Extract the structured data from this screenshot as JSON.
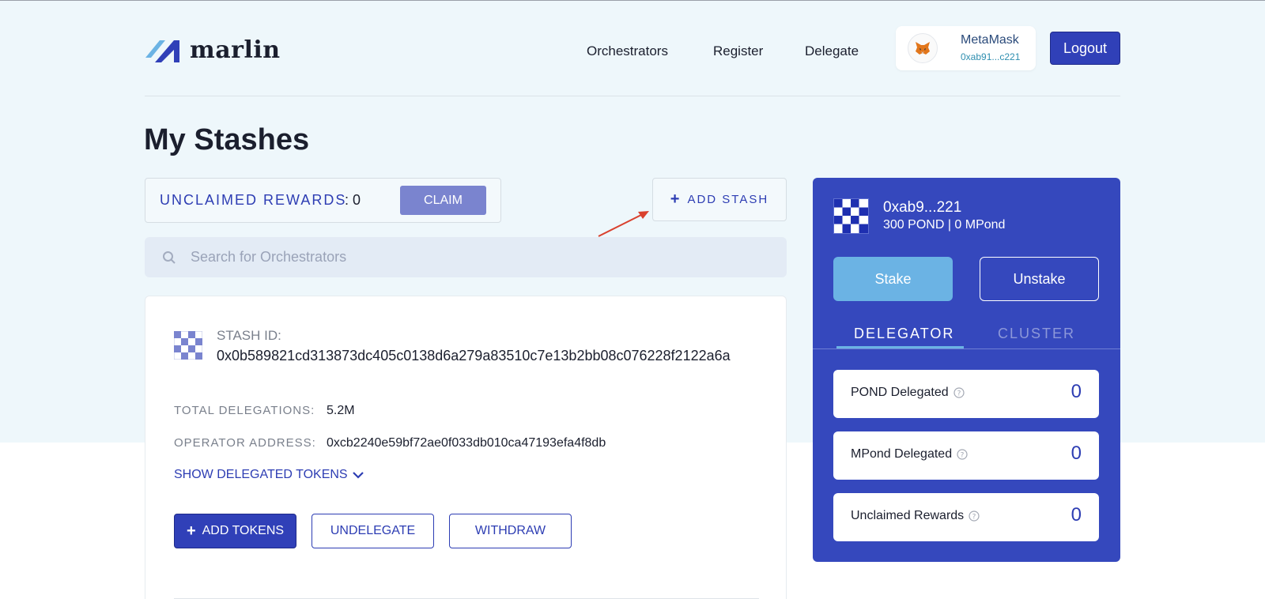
{
  "header": {
    "logo_text": "marlin",
    "nav": [
      "Orchestrators",
      "Register",
      "Delegate"
    ],
    "wallet": {
      "name": "MetaMask",
      "address": "0xab91...c221"
    },
    "logout_label": "Logout"
  },
  "page": {
    "title": "My Stashes"
  },
  "rewards": {
    "label": "UNCLAIMED REWARDS",
    "value": ": 0",
    "claim_label": "CLAIM"
  },
  "add_stash_label": "ADD STASH",
  "search": {
    "placeholder": "Search for Orchestrators"
  },
  "stash": {
    "id_label": "STASH ID:",
    "id_value": "0x0b589821cd313873dc405c0138d6a279a83510c7e13b2bb08c076228f2122a6a",
    "total_delegations_label": "TOTAL DELEGATIONS:",
    "total_delegations_value": "5.2M",
    "operator_label": "OPERATOR ADDRESS:",
    "operator_value": "0xcb2240e59bf72ae0f033db010ca47193efa4f8db",
    "show_tokens_label": "SHOW DELEGATED TOKENS",
    "add_tokens_label": "ADD TOKENS",
    "undelegate_label": "UNDELEGATE",
    "withdraw_label": "WITHDRAW"
  },
  "panel": {
    "address": "0xab9...221",
    "balance": "300 POND | 0 MPond",
    "stake_label": "Stake",
    "unstake_label": "Unstake",
    "tabs": [
      "DELEGATOR",
      "CLUSTER"
    ],
    "stats": [
      {
        "label": "POND Delegated",
        "value": "0"
      },
      {
        "label": "MPond Delegated",
        "value": "0"
      },
      {
        "label": "Unclaimed Rewards",
        "value": "0"
      }
    ]
  },
  "colors": {
    "accent": "#3548bd",
    "light_blue": "#6bb3e4",
    "annotation": "#d9412e"
  },
  "icons": [
    "marlin-logo-icon",
    "metamask-fox-icon",
    "plus-icon",
    "search-icon",
    "checker-avatar-icon",
    "chevron-down-icon",
    "help-circle-icon",
    "annotation-arrow-icon"
  ]
}
